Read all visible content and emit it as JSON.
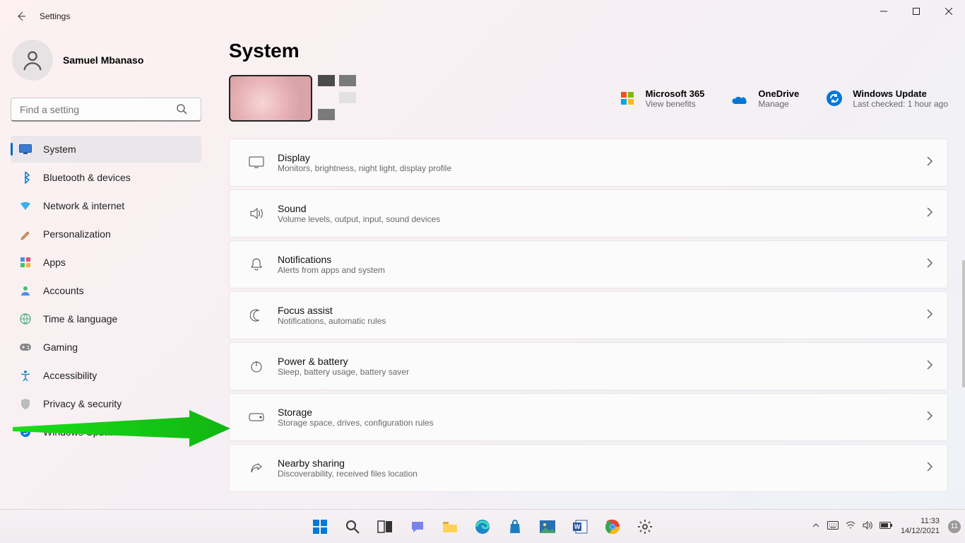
{
  "window": {
    "title": "Settings"
  },
  "user": {
    "name": "Samuel Mbanaso"
  },
  "search": {
    "placeholder": "Find a setting"
  },
  "nav": [
    {
      "label": "System",
      "icon": "system",
      "active": true
    },
    {
      "label": "Bluetooth & devices",
      "icon": "bluetooth"
    },
    {
      "label": "Network & internet",
      "icon": "wifi"
    },
    {
      "label": "Personalization",
      "icon": "brush"
    },
    {
      "label": "Apps",
      "icon": "apps"
    },
    {
      "label": "Accounts",
      "icon": "person"
    },
    {
      "label": "Time & language",
      "icon": "globe"
    },
    {
      "label": "Gaming",
      "icon": "gaming"
    },
    {
      "label": "Accessibility",
      "icon": "accessibility"
    },
    {
      "label": "Privacy & security",
      "icon": "shield"
    },
    {
      "label": "Windows Update",
      "icon": "update"
    }
  ],
  "page": {
    "title": "System"
  },
  "quicklinks": [
    {
      "title": "Microsoft 365",
      "sub": "View benefits",
      "icon": "ms365"
    },
    {
      "title": "OneDrive",
      "sub": "Manage",
      "icon": "onedrive"
    },
    {
      "title": "Windows Update",
      "sub": "Last checked: 1 hour ago",
      "icon": "update-sync"
    }
  ],
  "cards": [
    {
      "title": "Display",
      "sub": "Monitors, brightness, night light, display profile",
      "icon": "display"
    },
    {
      "title": "Sound",
      "sub": "Volume levels, output, input, sound devices",
      "icon": "sound"
    },
    {
      "title": "Notifications",
      "sub": "Alerts from apps and system",
      "icon": "bell"
    },
    {
      "title": "Focus assist",
      "sub": "Notifications, automatic rules",
      "icon": "moon"
    },
    {
      "title": "Power & battery",
      "sub": "Sleep, battery usage, battery saver",
      "icon": "power"
    },
    {
      "title": "Storage",
      "sub": "Storage space, drives, configuration rules",
      "icon": "storage"
    },
    {
      "title": "Nearby sharing",
      "sub": "Discoverability, received files location",
      "icon": "share"
    }
  ],
  "taskbar": {
    "time": "11:33",
    "date": "14/12/2021",
    "notif_count": "11"
  }
}
